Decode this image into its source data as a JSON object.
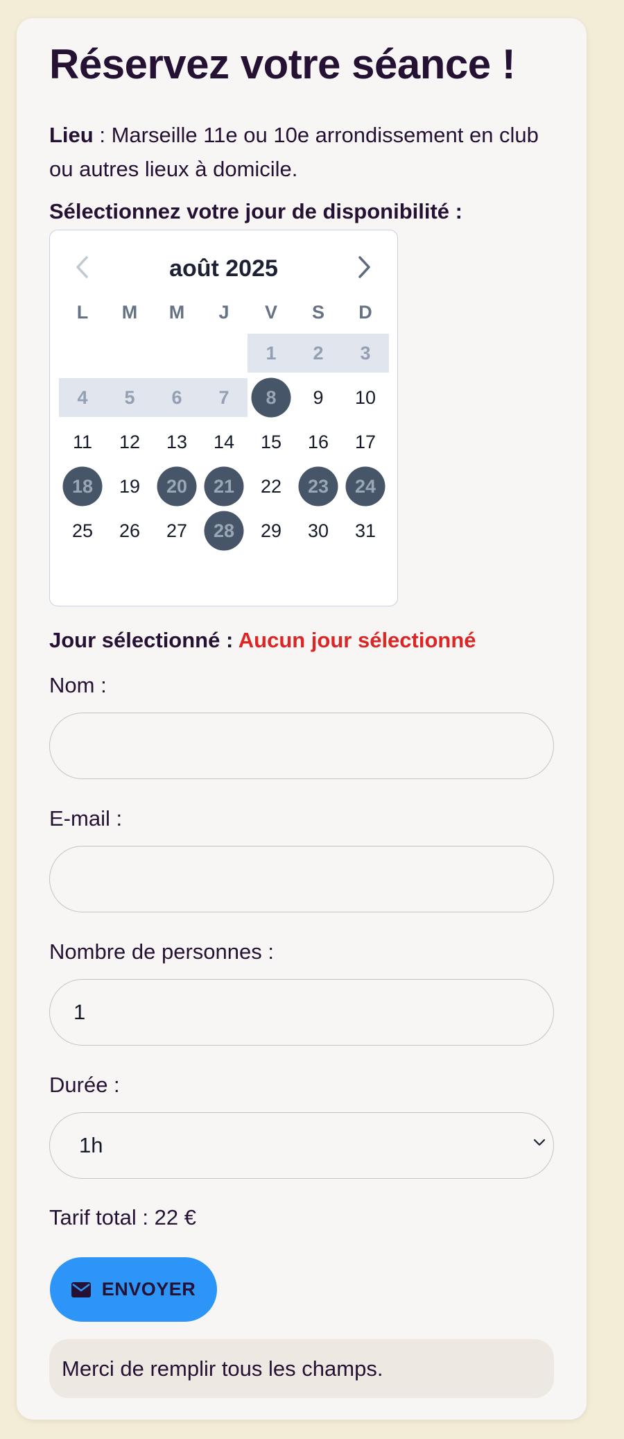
{
  "colors": {
    "page_background": "#f3ecd6",
    "card_background": "#f8f6f4",
    "accent_button": "#2d95f7",
    "error_text": "#dc2626",
    "booked_day": "#475569"
  },
  "page": {
    "title": "Réservez votre séance !",
    "lieu_label": "Lieu",
    "lieu_text": " : Marseille 11e ou 10e arrondissement en club ou autres lieux à domicile.",
    "select_day_label": "Sélectionnez votre jour de disponibilité :"
  },
  "calendar": {
    "month_label": "août 2025",
    "prev_icon": "chevron-left-icon",
    "next_icon": "chevron-right-icon",
    "weekdays": [
      "L",
      "M",
      "M",
      "J",
      "V",
      "S",
      "D"
    ],
    "weeks": [
      [
        "",
        "",
        "",
        "",
        "1",
        "2",
        "3"
      ],
      [
        "4",
        "5",
        "6",
        "7",
        "8",
        "9",
        "10"
      ],
      [
        "11",
        "12",
        "13",
        "14",
        "15",
        "16",
        "17"
      ],
      [
        "18",
        "19",
        "20",
        "21",
        "22",
        "23",
        "24"
      ],
      [
        "25",
        "26",
        "27",
        "28",
        "29",
        "30",
        "31"
      ]
    ],
    "past_days": [
      "1",
      "2",
      "3",
      "4",
      "5",
      "6",
      "7"
    ],
    "booked_days": [
      "8",
      "18",
      "20",
      "21",
      "23",
      "24",
      "28"
    ]
  },
  "selection": {
    "label": "Jour sélectionné : ",
    "value": "Aucun jour sélectionné"
  },
  "form": {
    "name_label": "Nom :",
    "name_value": "",
    "email_label": "E-mail :",
    "email_value": "",
    "people_label": "Nombre de personnes :",
    "people_value": "1",
    "duration_label": "Durée :",
    "duration_value": "1h",
    "tarif_text": "Tarif total : 22 €",
    "send_label": "ENVOYER",
    "send_icon": "envelope-icon",
    "message": "Merci de remplir tous les champs."
  }
}
